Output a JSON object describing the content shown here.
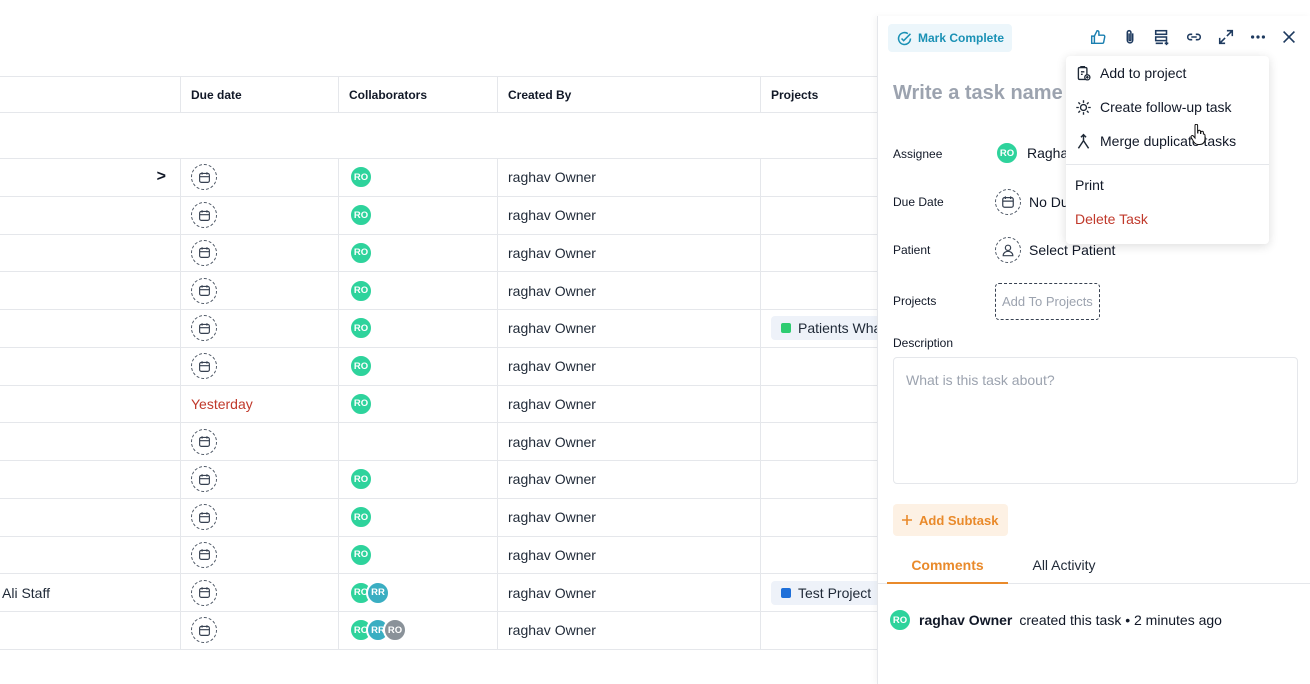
{
  "table": {
    "headers": {
      "due": "Due date",
      "collab": "Collaborators",
      "created": "Created By",
      "projects": "Projects"
    },
    "rows": [
      {
        "name": "",
        "due": "",
        "collab": [
          "RO"
        ],
        "created": "raghav Owner",
        "project": "",
        "chevron": ">"
      },
      {
        "name": "",
        "due": "",
        "collab": [
          "RO"
        ],
        "created": "raghav Owner",
        "project": ""
      },
      {
        "name": "",
        "due": "",
        "collab": [
          "RO"
        ],
        "created": "raghav Owner",
        "project": ""
      },
      {
        "name": "",
        "due": "",
        "collab": [
          "RO"
        ],
        "created": "raghav Owner",
        "project": ""
      },
      {
        "name": "",
        "due": "",
        "collab": [
          "RO"
        ],
        "created": "raghav Owner",
        "project": "Patients Wha",
        "project_color": "#2ecc71"
      },
      {
        "name": "",
        "due": "",
        "collab": [
          "RO"
        ],
        "created": "raghav Owner",
        "project": ""
      },
      {
        "name": "",
        "due": "Yesterday",
        "collab": [
          "RO"
        ],
        "created": "raghav Owner",
        "project": ""
      },
      {
        "name": "",
        "due": "",
        "collab": [],
        "created": "raghav Owner",
        "project": ""
      },
      {
        "name": "",
        "due": "",
        "collab": [
          "RO"
        ],
        "created": "raghav Owner",
        "project": ""
      },
      {
        "name": "",
        "due": "",
        "collab": [
          "RO"
        ],
        "created": "raghav Owner",
        "project": ""
      },
      {
        "name": "",
        "due": "",
        "collab": [
          "RO"
        ],
        "created": "raghav Owner",
        "project": ""
      },
      {
        "name": "Ali Staff",
        "due": "",
        "collab": [
          "RO",
          "RR"
        ],
        "created": "raghav Owner",
        "project": "Test Project",
        "project_color": "#1e6fd9"
      },
      {
        "name": "",
        "due": "",
        "collab": [
          "RO",
          "RR",
          "RO"
        ],
        "created": "raghav Owner",
        "project": ""
      }
    ]
  },
  "avatar_colors": {
    "RO": "#2ed39c",
    "RR": "#3aaec2",
    "RO_gray": "#8a9299"
  },
  "panel": {
    "mark_complete": "Mark Complete",
    "title_placeholder": "Write a task name",
    "assignee_label": "Assignee",
    "assignee_initials": "RO",
    "assignee_value": "Ragha",
    "due_label": "Due Date",
    "due_value": "No Du",
    "patient_label": "Patient",
    "patient_value": "Select Patient",
    "projects_label": "Projects",
    "add_to_projects": "Add To Projects",
    "description_label": "Description",
    "description_placeholder": "What is this task about?",
    "add_subtask": "Add Subtask",
    "tabs": [
      "Comments",
      "All Activity"
    ],
    "activity": {
      "initials": "RO",
      "user": "raghav Owner",
      "text": "created this task • 2 minutes ago"
    }
  },
  "menu": {
    "items": [
      "Add to project",
      "Create follow-up task",
      "Merge duplicate tasks"
    ],
    "print": "Print",
    "delete": "Delete Task"
  },
  "colors": {
    "accent_orange": "#e98a2b",
    "accent_blue": "#1a91b5",
    "danger": "#c0392b"
  }
}
